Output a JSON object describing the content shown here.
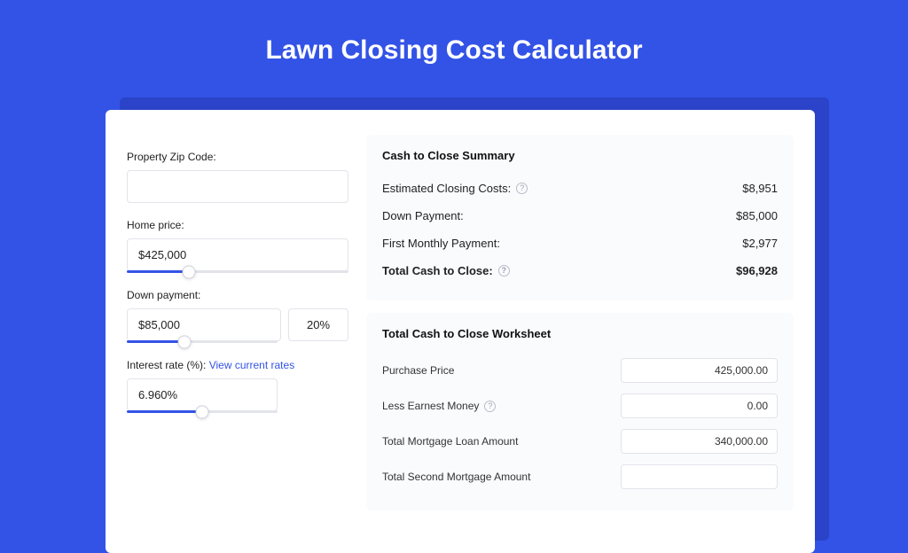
{
  "title": "Lawn Closing Cost Calculator",
  "form": {
    "zip": {
      "label": "Property Zip Code:",
      "value": ""
    },
    "home_price": {
      "label": "Home price:",
      "value": "$425,000",
      "slider_pct": 28
    },
    "down_payment": {
      "label": "Down payment:",
      "value": "$85,000",
      "pct_value": "20%",
      "slider_pct": 38
    },
    "interest": {
      "label": "Interest rate (%): ",
      "link_text": "View current rates",
      "value": "6.960%",
      "slider_pct": 50
    }
  },
  "summary": {
    "heading": "Cash to Close Summary",
    "rows": [
      {
        "label": "Estimated Closing Costs:",
        "value": "$8,951",
        "help": true
      },
      {
        "label": "Down Payment:",
        "value": "$85,000",
        "help": false
      },
      {
        "label": "First Monthly Payment:",
        "value": "$2,977",
        "help": false
      }
    ],
    "total": {
      "label": "Total Cash to Close:",
      "value": "$96,928",
      "help": true
    }
  },
  "worksheet": {
    "heading": "Total Cash to Close Worksheet",
    "rows": [
      {
        "label": "Purchase Price",
        "value": "425,000.00",
        "help": false
      },
      {
        "label": "Less Earnest Money",
        "value": "0.00",
        "help": true
      },
      {
        "label": "Total Mortgage Loan Amount",
        "value": "340,000.00",
        "help": false
      },
      {
        "label": "Total Second Mortgage Amount",
        "value": "",
        "help": false
      }
    ]
  }
}
